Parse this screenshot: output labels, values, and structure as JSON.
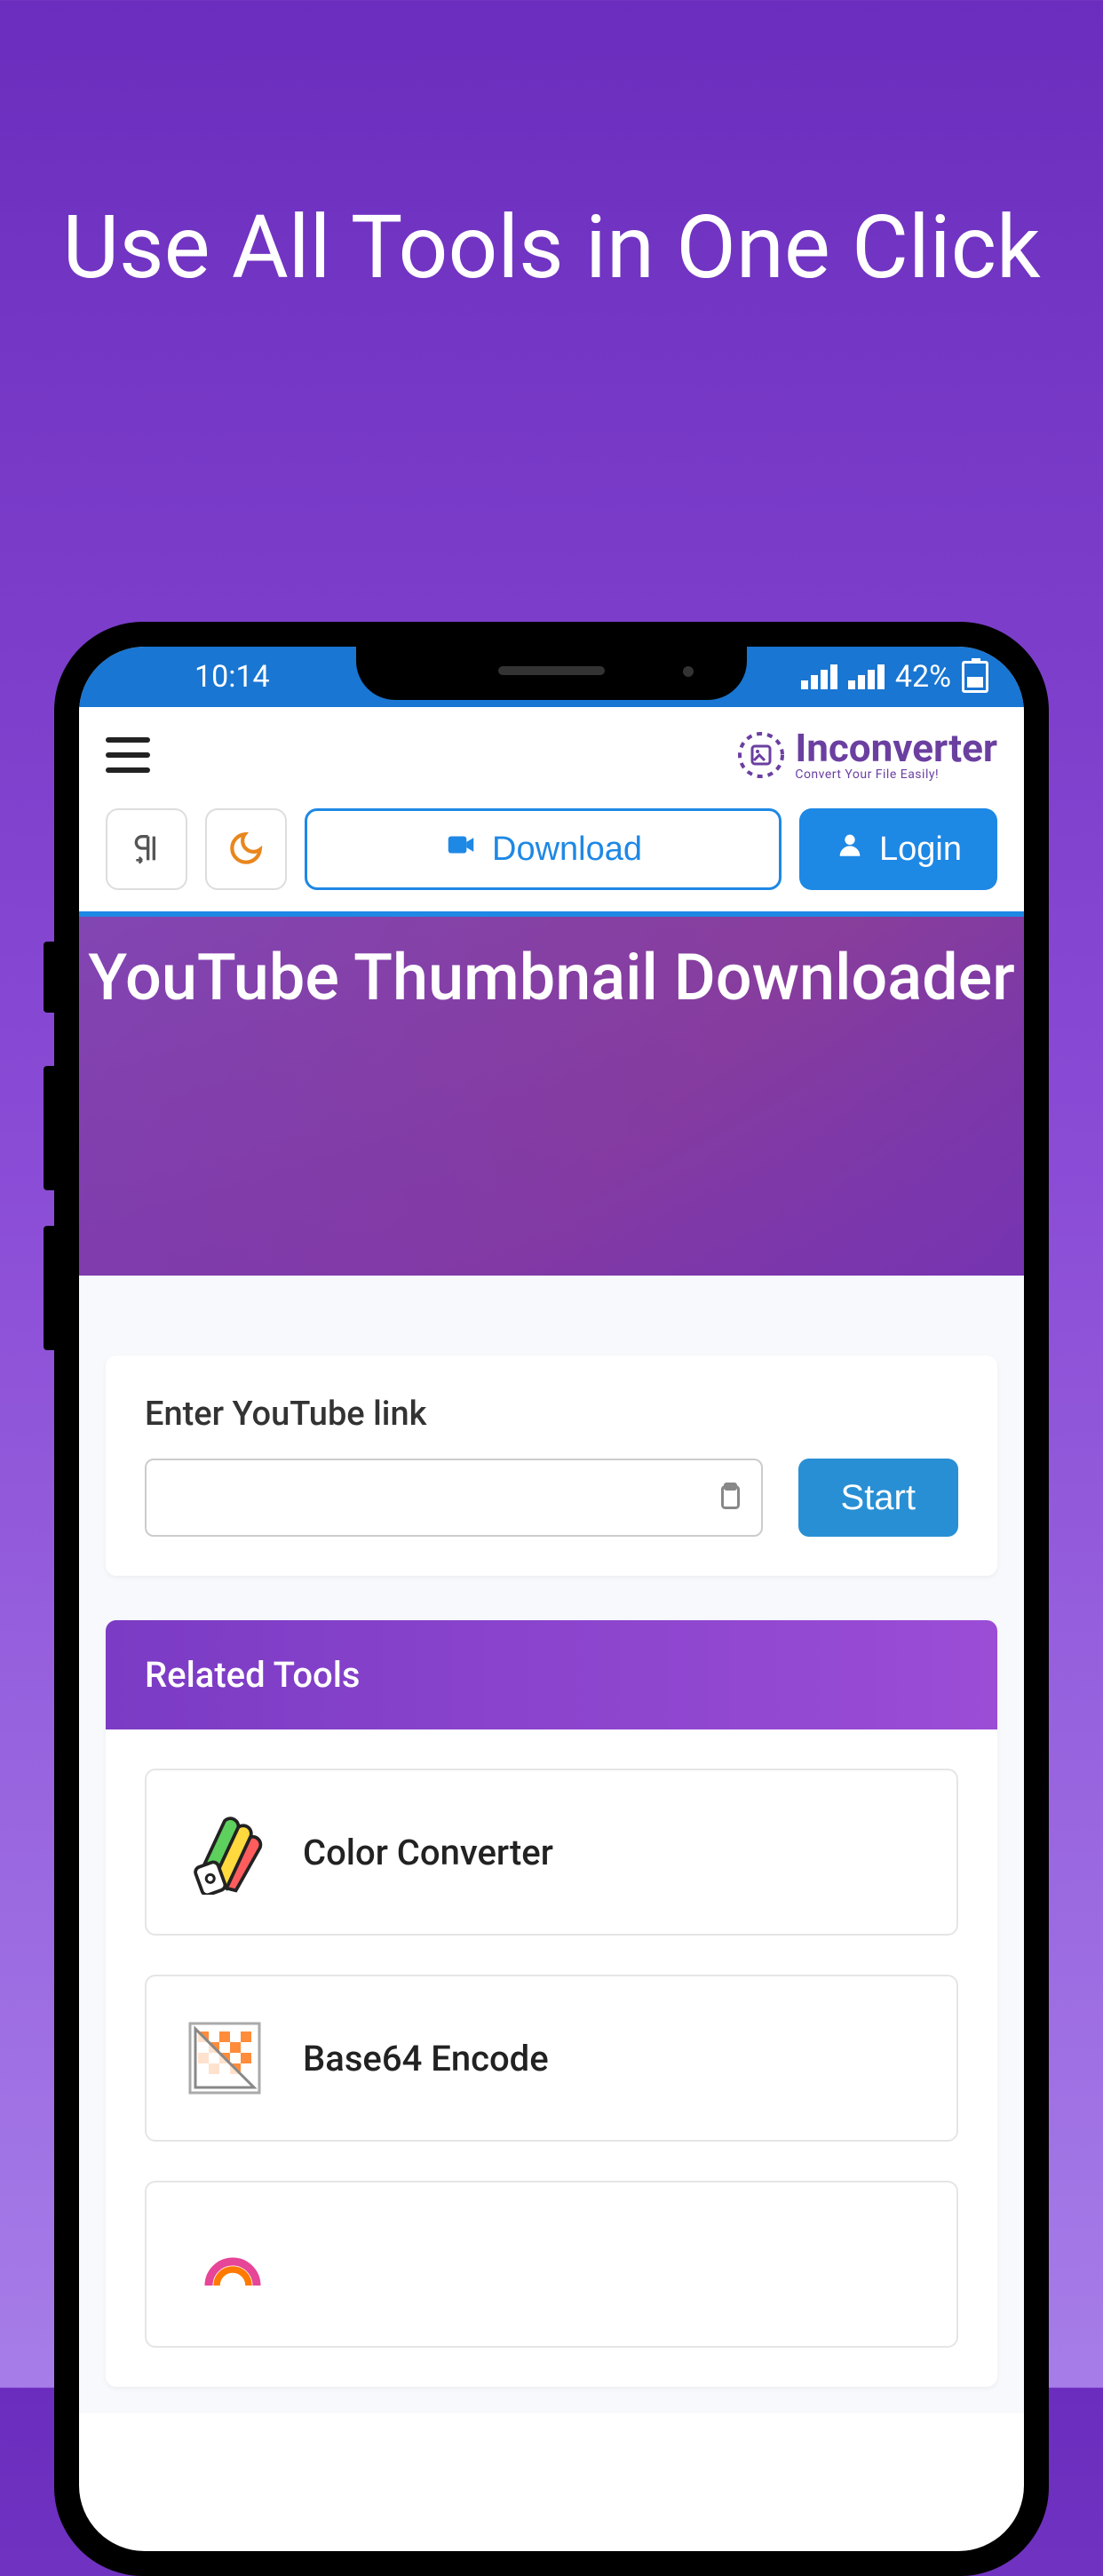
{
  "promo": {
    "heading": "Use All Tools in One Click"
  },
  "status": {
    "time": "10:14",
    "battery_text": "42%"
  },
  "brand": {
    "name": "Inconverter",
    "tagline": "Convert Your File Easily!"
  },
  "toolbar": {
    "download_label": "Download",
    "login_label": "Login"
  },
  "hero": {
    "title": "YouTube Thumbnail Downloader"
  },
  "input": {
    "label": "Enter YouTube link",
    "value": "",
    "start_label": "Start"
  },
  "related": {
    "heading": "Related Tools",
    "items": [
      {
        "label": "Color Converter",
        "icon": "palette-icon"
      },
      {
        "label": "Base64 Encode",
        "icon": "checker-icon"
      }
    ]
  },
  "colors": {
    "accent_blue": "#1e88e5",
    "accent_purple": "#7b3bc4"
  }
}
